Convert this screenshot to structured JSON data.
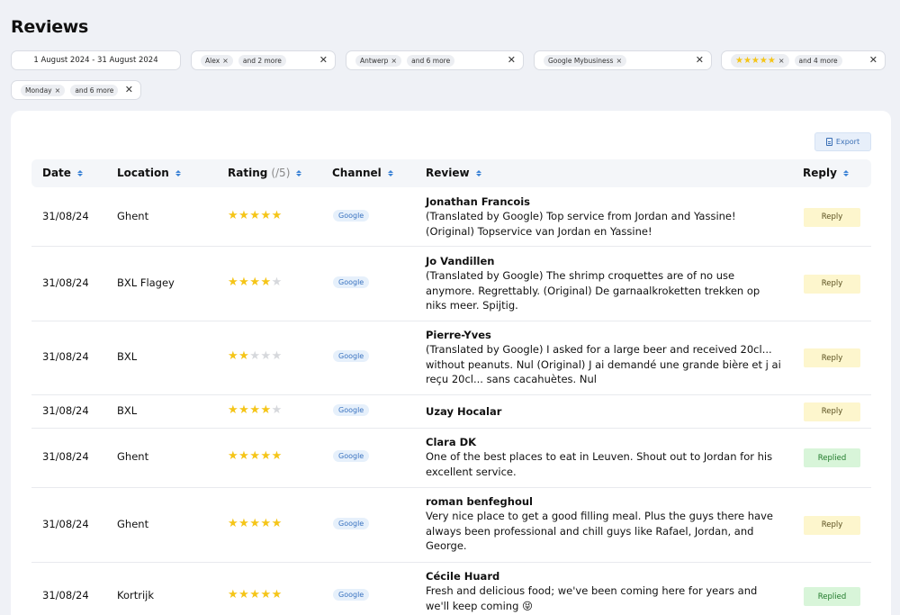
{
  "page": {
    "title": "Reviews"
  },
  "filters": {
    "date_range": "1 August 2024 - 31 August 2024",
    "users": {
      "chip": "Alex",
      "more": "and 2 more"
    },
    "locations": {
      "chip": "Antwerp",
      "more": "and 6 more"
    },
    "channels": {
      "chip": "Google Mybusiness"
    },
    "ratings": {
      "chip_stars": "★★★★★",
      "more": "and 4 more"
    },
    "days": {
      "chip": "Monday",
      "more": "and 6 more"
    },
    "remove_glyph": "×",
    "clear_glyph": "✕"
  },
  "toolbar": {
    "export_label": "Export"
  },
  "table": {
    "headers": {
      "date": "Date",
      "location": "Location",
      "rating": "Rating",
      "rating_suffix": "(/5)",
      "channel": "Channel",
      "review": "Review",
      "reply": "Reply"
    },
    "rows": [
      {
        "date": "31/08/24",
        "location": "Ghent",
        "rating": 5,
        "channel": "Google",
        "author": "Jonathan Francois",
        "text": "(Translated by Google) Top service from Jordan and Yassine! (Original) Topservice van Jordan en Yassine!",
        "reply": "Reply",
        "replied": false
      },
      {
        "date": "31/08/24",
        "location": "BXL Flagey",
        "rating": 4,
        "channel": "Google",
        "author": "Jo Vandillen",
        "text": "(Translated by Google) The shrimp croquettes are of no use anymore. Regrettably. (Original) De garnaalkroketten trekken op niks meer. Spijtig.",
        "reply": "Reply",
        "replied": false
      },
      {
        "date": "31/08/24",
        "location": "BXL",
        "rating": 2,
        "channel": "Google",
        "author": "Pierre-Yves",
        "text": "(Translated by Google) I asked for a large beer and received 20cl... without peanuts. Nul (Original) J ai demandé une grande bière et j ai reçu 20cl... sans cacahuètes. Nul",
        "reply": "Reply",
        "replied": false
      },
      {
        "date": "31/08/24",
        "location": "BXL",
        "rating": 4,
        "channel": "Google",
        "author": "Uzay Hocalar",
        "text": "",
        "reply": "Reply",
        "replied": false
      },
      {
        "date": "31/08/24",
        "location": "Ghent",
        "rating": 5,
        "channel": "Google",
        "author": "Clara DK",
        "text": "One of the best places to eat in Leuven. Shout out to Jordan for his excellent service.",
        "reply": "Replied",
        "replied": true
      },
      {
        "date": "31/08/24",
        "location": "Ghent",
        "rating": 5,
        "channel": "Google",
        "author": "roman benfeghoul",
        "text": "Very nice place to get a good filling meal. Plus the guys there have always been professional and chill guys like Rafael, Jordan, and George.",
        "reply": "Reply",
        "replied": false
      },
      {
        "date": "31/08/24",
        "location": "Kortrijk",
        "rating": 5,
        "channel": "Google",
        "author": "Cécile Huard",
        "text": "Fresh and delicious food; we've been coming here for years and we'll keep coming 😝",
        "reply": "Replied",
        "replied": true
      }
    ]
  }
}
